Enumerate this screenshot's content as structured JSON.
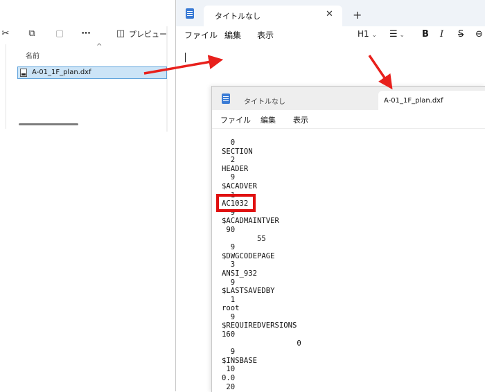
{
  "explorer": {
    "toolbar": {
      "cut_icon": "cut-icon",
      "copy_icon": "copy-icon",
      "paste_icon": "paste-icon",
      "more_icon": "more-icon",
      "preview_label": "プレビュー"
    },
    "column_header": "名前",
    "file": {
      "name": "A-01_1F_plan.dxf",
      "icon": "dxf-file-icon"
    }
  },
  "notepad_main": {
    "tab_title": "タイトルなし",
    "close_glyph": "✕",
    "new_tab_glyph": "+",
    "menu": [
      "ファイル",
      "編集",
      "表示"
    ],
    "format_toolbar": {
      "heading": "H1",
      "list_icon": "list-icon",
      "bold": "B",
      "italic": "I",
      "strike": "S",
      "link_icon": "link-icon"
    }
  },
  "notepad_inset": {
    "tab1_title": "タイトルなし",
    "tab2_title": "A-01_1F_plan.dxf",
    "menu": [
      "ファイル",
      "編集",
      "表示"
    ],
    "content": "  0\nSECTION\n  2\nHEADER\n  9\n$ACADVER\n  1\nAC1032\n  9\n$ACADMAINTVER\n 90\n        55\n  9\n$DWGCODEPAGE\n  3\nANSI_932\n  9\n$LASTSAVEDBY\n  1\nroot\n  9\n$REQUIREDVERSIONS\n160\n                 0\n  9\n$INSBASE\n 10\n0.0\n 20",
    "highlighted_value": "AC1032"
  },
  "annotation": {
    "arrow_color": "#e8201c",
    "highlight_color": "#e01010"
  }
}
